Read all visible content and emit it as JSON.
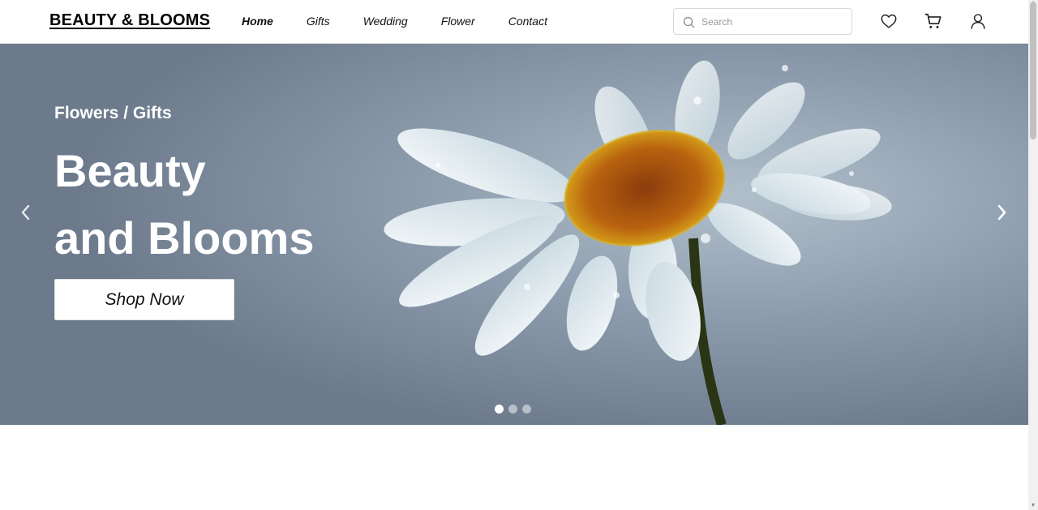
{
  "header": {
    "logo": "BEAUTY & BLOOMS",
    "nav": [
      {
        "label": "Home",
        "active": true
      },
      {
        "label": "Gifts",
        "active": false
      },
      {
        "label": "Wedding",
        "active": false
      },
      {
        "label": "Flower",
        "active": false
      },
      {
        "label": "Contact",
        "active": false
      }
    ],
    "search": {
      "placeholder": "Search",
      "value": "",
      "icon": "search-icon"
    },
    "icons": [
      "heart-icon",
      "cart-icon",
      "user-icon"
    ]
  },
  "hero": {
    "subtitle": "Flowers / Gifts",
    "title_line1": "Beauty",
    "title_line2": "and Blooms",
    "cta_label": "Shop Now",
    "image": "white-daisy-with-water-droplets",
    "prev_icon": "chevron-left-icon",
    "next_icon": "chevron-right-icon",
    "slides": 3,
    "active_slide": 1
  },
  "colors": {
    "hero_background": "#8b9aab",
    "text_on_hero": "#ffffff",
    "button_background": "#ffffff"
  }
}
